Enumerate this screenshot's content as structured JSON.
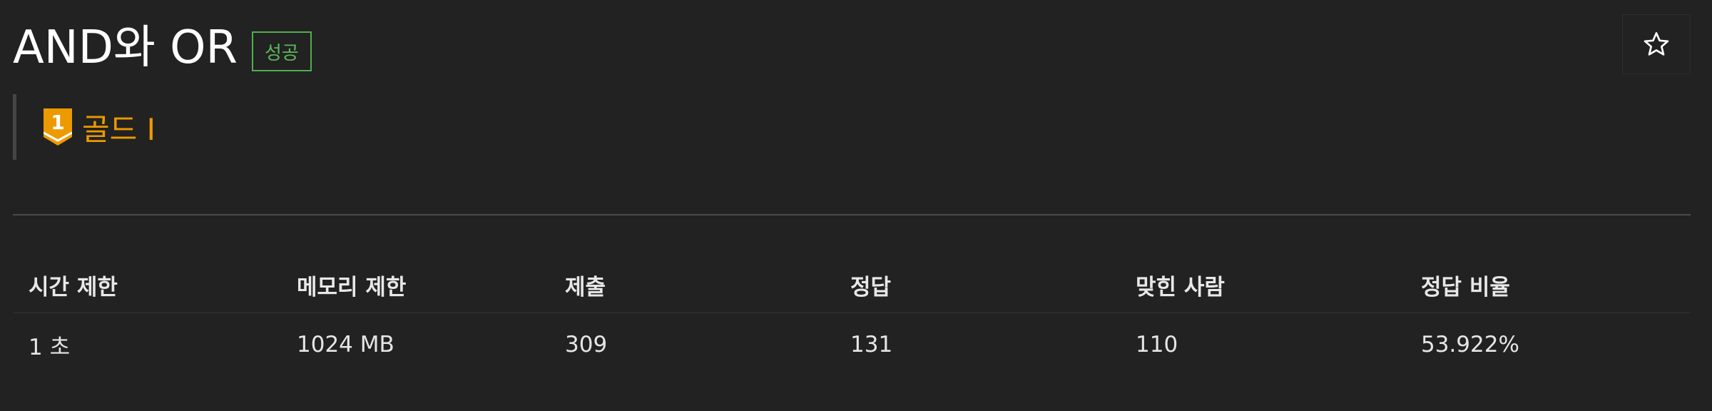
{
  "problem": {
    "title": "AND와 OR",
    "status": "성공",
    "tier": {
      "label": "골드 I",
      "level": "1",
      "color": "#ec9a00"
    }
  },
  "star": {
    "icon": "star-outline-icon"
  },
  "info_table": {
    "headers": [
      "시간 제한",
      "메모리 제한",
      "제출",
      "정답",
      "맞힌 사람",
      "정답 비율"
    ],
    "values": [
      "1 초",
      "1024 MB",
      "309",
      "131",
      "110",
      "53.922%"
    ]
  }
}
